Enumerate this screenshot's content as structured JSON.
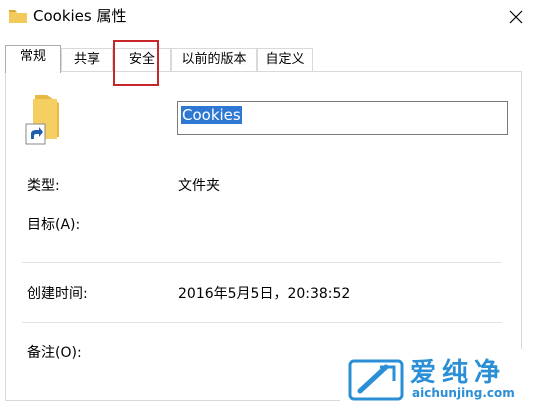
{
  "window": {
    "title": "Cookies 属性"
  },
  "tabs": [
    {
      "label": "常规"
    },
    {
      "label": "共享"
    },
    {
      "label": "安全"
    },
    {
      "label": "以前的版本"
    },
    {
      "label": "自定义"
    }
  ],
  "general": {
    "name_value": "Cookies",
    "type_label": "类型:",
    "type_value": "文件夹",
    "target_label": "目标(A):",
    "created_label": "创建时间:",
    "created_value": "2016年5月5日，20:38:52",
    "comment_label": "备注(O):"
  },
  "watermark": {
    "title": "爱纯净",
    "url": "aichunjing.com"
  },
  "colors": {
    "highlight": "#c8262d",
    "selection": "#2e78d4",
    "brand": "#2a8fd6",
    "folder": "#f3c95a"
  }
}
